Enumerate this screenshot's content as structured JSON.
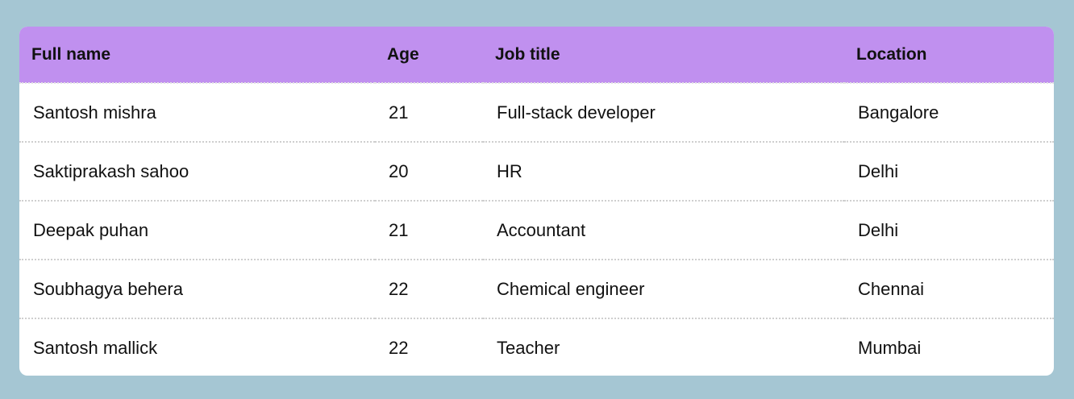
{
  "table": {
    "headers": {
      "full_name": "Full name",
      "age": "Age",
      "job_title": "Job title",
      "location": "Location"
    },
    "rows": [
      {
        "full_name": "Santosh mishra",
        "age": "21",
        "job_title": "Full-stack developer",
        "location": "Bangalore"
      },
      {
        "full_name": "Saktiprakash sahoo",
        "age": "20",
        "job_title": "HR",
        "location": "Delhi"
      },
      {
        "full_name": "Deepak puhan",
        "age": "21",
        "job_title": "Accountant",
        "location": "Delhi"
      },
      {
        "full_name": "Soubhagya behera",
        "age": "22",
        "job_title": "Chemical engineer",
        "location": "Chennai"
      },
      {
        "full_name": "Santosh mallick",
        "age": "22",
        "job_title": "Teacher",
        "location": "Mumbai"
      }
    ]
  },
  "colors": {
    "page_background": "#a5c6d3",
    "header_background": "#c090ef",
    "table_background": "#ffffff",
    "row_divider": "#cfcfcf"
  }
}
